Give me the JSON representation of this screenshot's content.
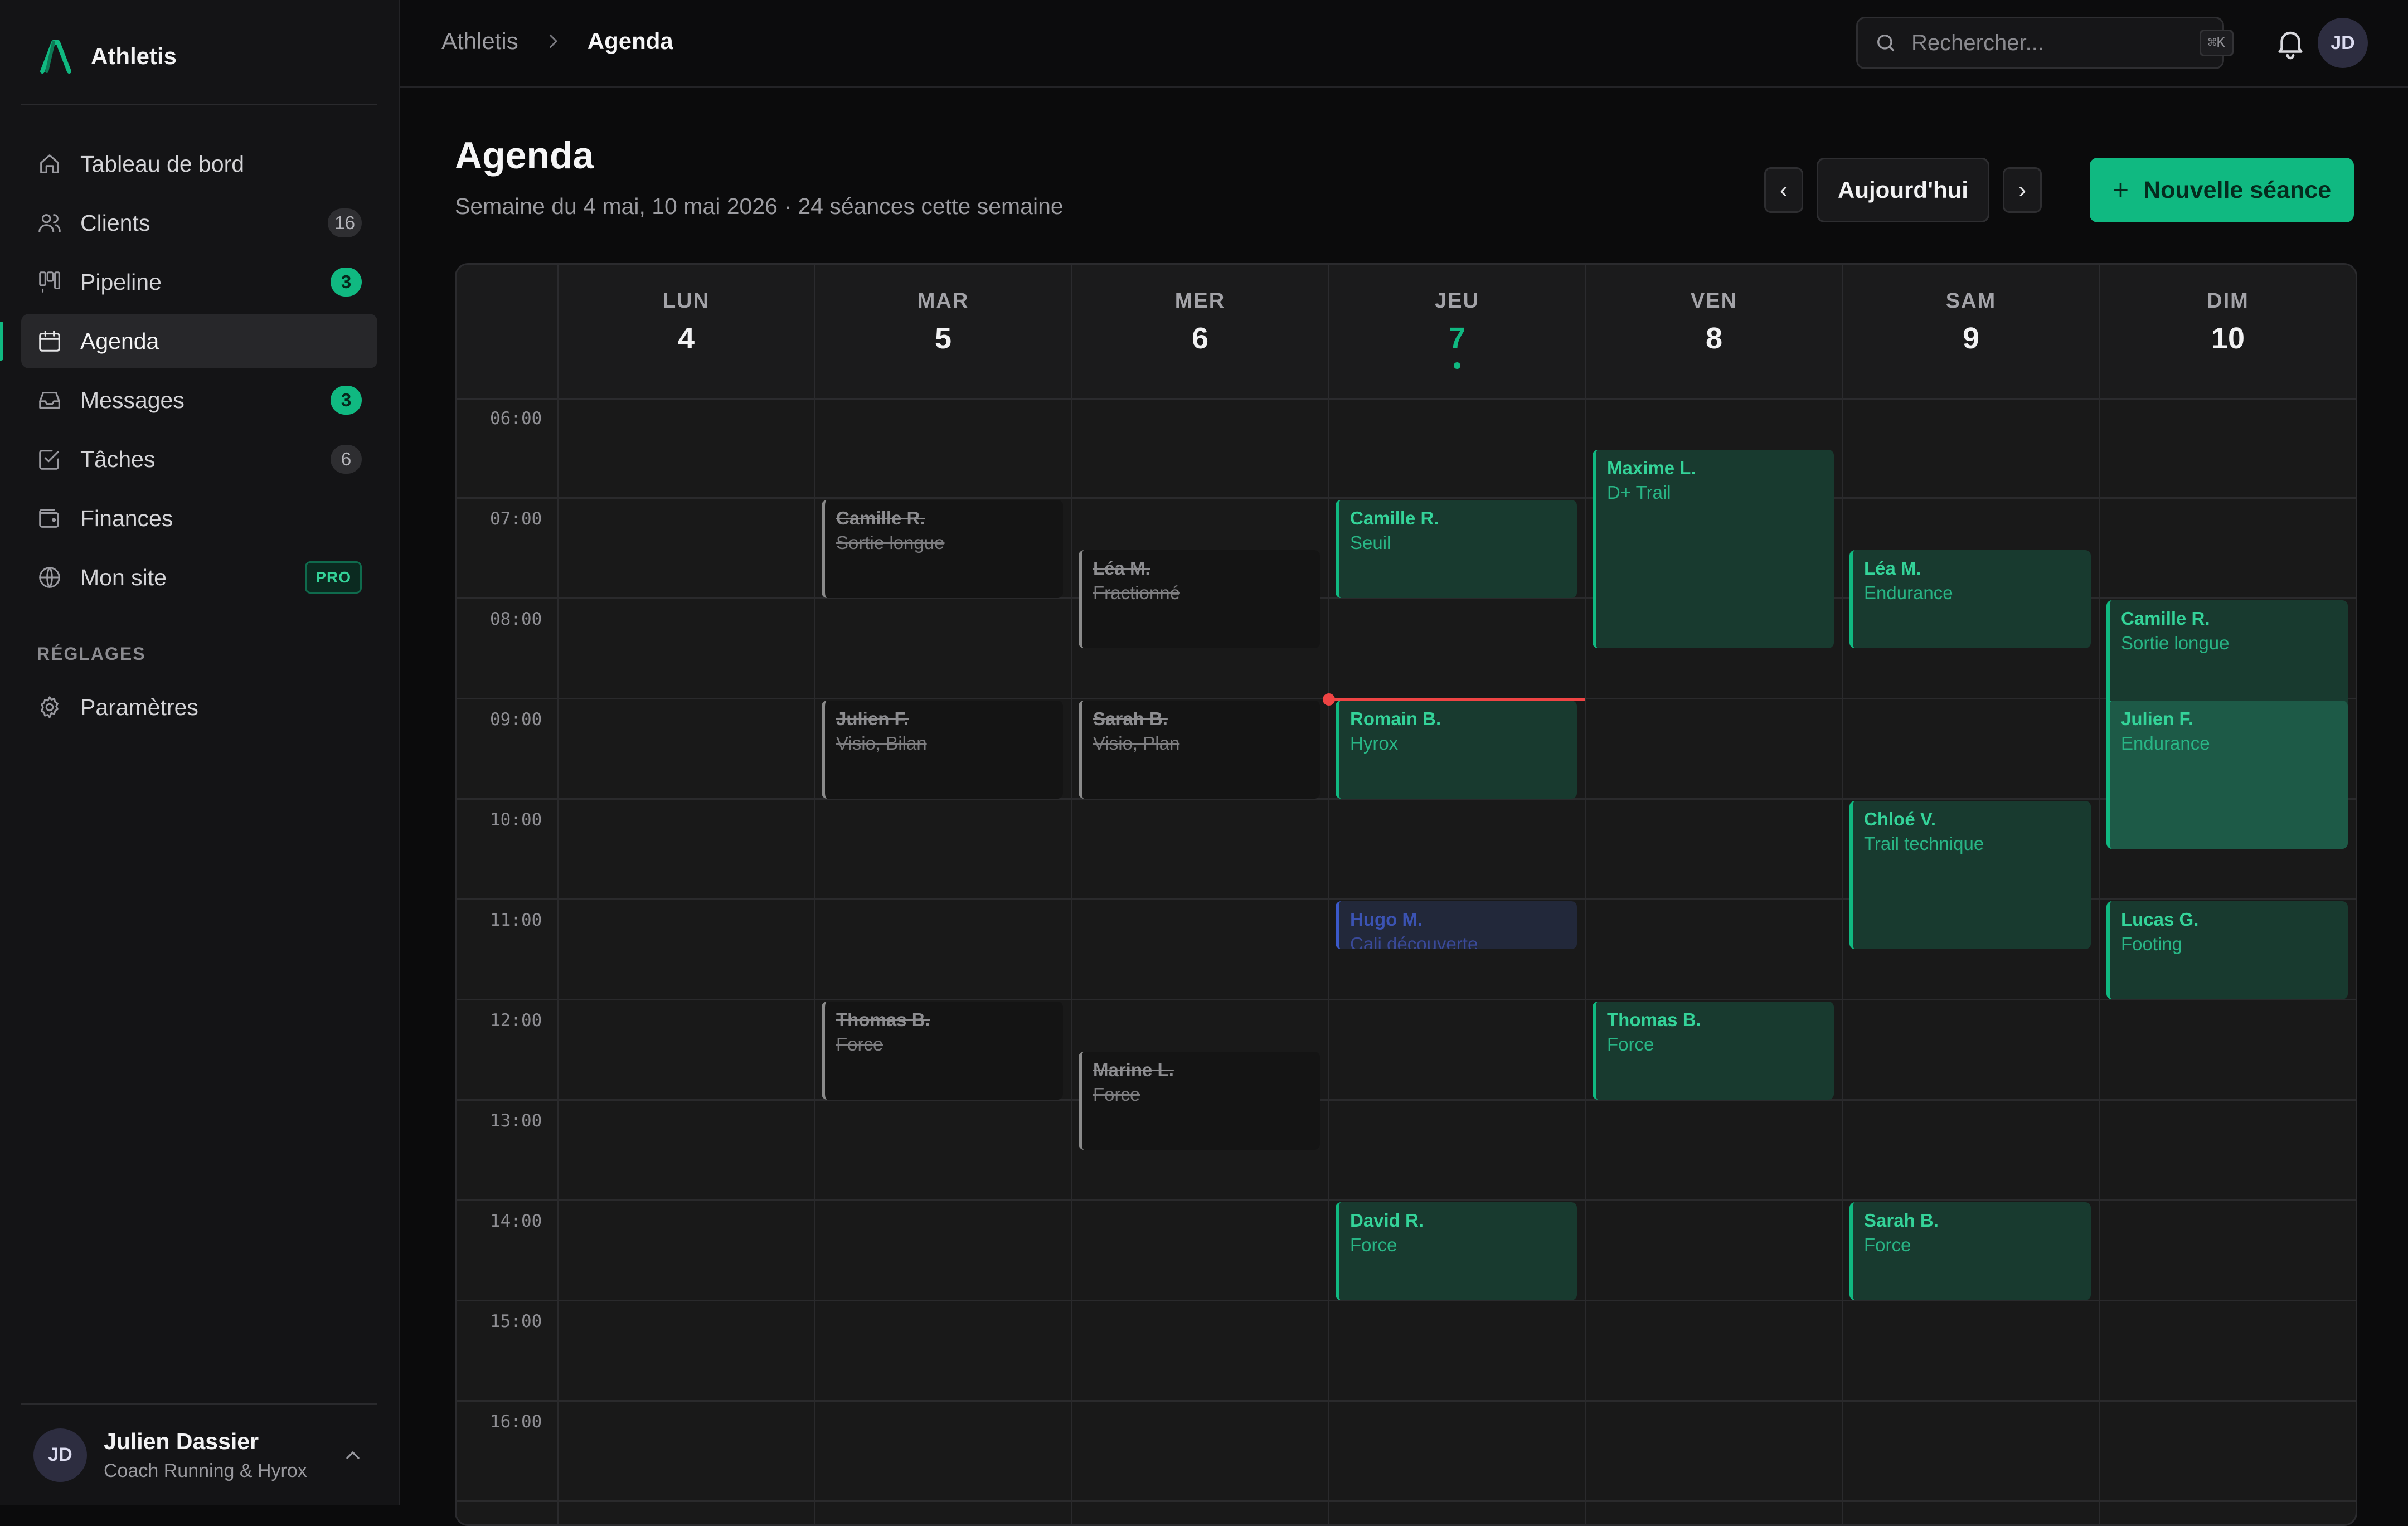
{
  "app": {
    "name": "Athletis"
  },
  "sidebar": {
    "items": [
      {
        "label": "Tableau de bord",
        "icon": "home-icon",
        "badge": ""
      },
      {
        "label": "Clients",
        "icon": "users-icon",
        "badge": "16"
      },
      {
        "label": "Pipeline",
        "icon": "kanban-icon",
        "badge": "3"
      },
      {
        "label": "Agenda",
        "icon": "calendar-icon",
        "badge": ""
      },
      {
        "label": "Messages",
        "icon": "inbox-icon",
        "badge": "3"
      },
      {
        "label": "Tâches",
        "icon": "check-square-icon",
        "badge": "6"
      },
      {
        "label": "Finances",
        "icon": "wallet-icon",
        "badge": ""
      },
      {
        "label": "Mon site",
        "icon": "globe-icon",
        "badge": "PRO"
      }
    ],
    "settings_title": "RÉGLAGES",
    "settings_items": [
      {
        "label": "Paramètres",
        "icon": "gear-icon"
      }
    ],
    "user": {
      "initials": "JD",
      "name": "Julien Dassier",
      "role": "Coach Running & Hyrox"
    }
  },
  "topbar": {
    "breadcrumb_root": "Athletis",
    "breadcrumb_current": "Agenda",
    "search_placeholder": "Rechercher...",
    "search_shortcut": "⌘K",
    "avatar_initials": "JD"
  },
  "page": {
    "title": "Agenda",
    "subtitle": "Semaine du 4 mai, 10 mai 2026 · 24 séances cette semaine",
    "prev_label": "‹",
    "next_label": "›",
    "today_label": "Aujourd'hui",
    "new_label": "Nouvelle séance",
    "new_icon": "+"
  },
  "calendar": {
    "days": [
      {
        "name": "LUN",
        "num": "4"
      },
      {
        "name": "MAR",
        "num": "5"
      },
      {
        "name": "MER",
        "num": "6"
      },
      {
        "name": "JEU",
        "num": "7",
        "today": true
      },
      {
        "name": "VEN",
        "num": "8"
      },
      {
        "name": "SAM",
        "num": "9"
      },
      {
        "name": "DIM",
        "num": "10"
      }
    ],
    "hours": [
      "06:00",
      "07:00",
      "08:00",
      "09:00",
      "10:00",
      "11:00",
      "12:00",
      "13:00",
      "14:00",
      "15:00",
      "16:00"
    ],
    "now_time": "09:00",
    "colors": {
      "accent": "#10b981",
      "now": "#ef4444",
      "pending": "#3b59c9"
    },
    "events": [
      {
        "day": 1,
        "start": "07:00",
        "end": "08:00",
        "name": "Camille R.",
        "type": "Sortie longue",
        "status": "cancelled"
      },
      {
        "day": 2,
        "start": "07:30",
        "end": "08:30",
        "name": "Léa M.",
        "type": "Fractionné",
        "status": "cancelled"
      },
      {
        "day": 3,
        "start": "07:00",
        "end": "08:00",
        "name": "Camille R.",
        "type": "Seuil",
        "status": "confirmed"
      },
      {
        "day": 4,
        "start": "06:30",
        "end": "08:30",
        "name": "Maxime L.",
        "type": "D+ Trail",
        "status": "confirmed"
      },
      {
        "day": 5,
        "start": "07:30",
        "end": "08:30",
        "name": "Léa M.",
        "type": "Endurance",
        "status": "confirmed"
      },
      {
        "day": 6,
        "start": "08:00",
        "end": "10:00",
        "name": "Camille R.",
        "type": "Sortie longue",
        "status": "confirmed"
      },
      {
        "day": 1,
        "start": "09:00",
        "end": "10:00",
        "name": "Julien F.",
        "type": "Visio, Bilan",
        "status": "cancelled"
      },
      {
        "day": 2,
        "start": "09:00",
        "end": "10:00",
        "name": "Sarah B.",
        "type": "Visio, Plan",
        "status": "cancelled"
      },
      {
        "day": 3,
        "start": "09:00",
        "end": "10:00",
        "name": "Romain B.",
        "type": "Hyrox",
        "status": "confirmed"
      },
      {
        "day": 6,
        "start": "09:00",
        "end": "10:30",
        "name": "Julien F.",
        "type": "Endurance",
        "status": "highlight"
      },
      {
        "day": 5,
        "start": "10:00",
        "end": "11:30",
        "name": "Chloé V.",
        "type": "Trail technique",
        "status": "confirmed"
      },
      {
        "day": 3,
        "start": "11:00",
        "end": "11:30",
        "name": "Hugo M.",
        "type": "Cali découverte",
        "status": "pending"
      },
      {
        "day": 6,
        "start": "11:00",
        "end": "12:00",
        "name": "Lucas G.",
        "type": "Footing",
        "status": "confirmed"
      },
      {
        "day": 1,
        "start": "12:00",
        "end": "13:00",
        "name": "Thomas B.",
        "type": "Force",
        "status": "cancelled"
      },
      {
        "day": 4,
        "start": "12:00",
        "end": "13:00",
        "name": "Thomas B.",
        "type": "Force",
        "status": "confirmed"
      },
      {
        "day": 2,
        "start": "12:30",
        "end": "13:30",
        "name": "Marine L.",
        "type": "Force",
        "status": "cancelled"
      },
      {
        "day": 3,
        "start": "14:00",
        "end": "15:00",
        "name": "David R.",
        "type": "Force",
        "status": "confirmed"
      },
      {
        "day": 5,
        "start": "14:00",
        "end": "15:00",
        "name": "Sarah B.",
        "type": "Force",
        "status": "confirmed"
      }
    ]
  }
}
